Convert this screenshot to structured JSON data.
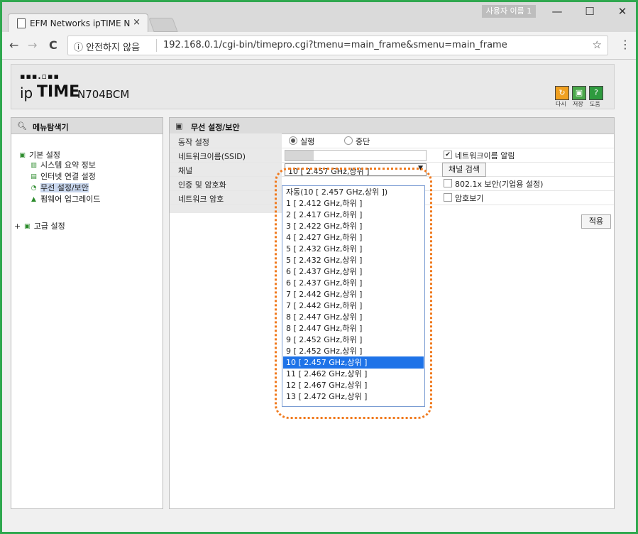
{
  "browser": {
    "tab_title": "EFM Networks ipTIME N",
    "tab_close": "×",
    "profile": "사용자 이름 1",
    "minimize": "—",
    "maximize": "☐",
    "close": "✕",
    "back": "←",
    "forward": "→",
    "reload": "C",
    "security": "ⓘ 안전하지 않음",
    "url": "192.168.0.1/cgi-bin/timepro.cgi?tmenu=main_frame&smenu=main_frame",
    "bookmark": "☆",
    "menu": "⋮"
  },
  "header": {
    "logo_dots": "▪▪▪.▫▪▪",
    "logo_ip": "ip",
    "logo_time": "TIME",
    "model": "N704BCM",
    "toolbar": [
      {
        "label": "다시",
        "icon": "refresh-icon",
        "color": "#f0a020"
      },
      {
        "label": "저장",
        "icon": "save-icon",
        "color": "#4aa84a"
      },
      {
        "label": "도움",
        "icon": "help-icon",
        "color": "#2e9a3e"
      }
    ]
  },
  "sidebar": {
    "title": "메뉴탐색기",
    "groups": [
      {
        "label": "기본 설정",
        "expanded": true,
        "items": [
          "시스템 요약 정보",
          "인터넷 연결 설정",
          "무선 설정/보안",
          "펌웨어 업그레이드"
        ]
      },
      {
        "label": "고급 설정",
        "expanded": false
      }
    ],
    "selected_item": "무선 설정/보안"
  },
  "main": {
    "title": "무선 설정/보안",
    "rows": [
      {
        "label": "동작 설정"
      },
      {
        "label": "네트워크이름(SSID)"
      },
      {
        "label": "채널"
      },
      {
        "label": "인증 및 암호화"
      },
      {
        "label": "네트워크 암호"
      }
    ],
    "mode_options": [
      "실행",
      "중단"
    ],
    "mode_selected": "실행",
    "ssid_broadcast_label": "네트워크이름 알림",
    "ssid_broadcast_checked": true,
    "channel_selected": "10 [ 2.457 GHz,상위 ]",
    "channel_scan_button": "채널 검색",
    "enterprise_label": "802.1x 보안(기업용 설정)",
    "show_password_label": "암호보기",
    "apply_button": "적용"
  },
  "channel_dropdown": {
    "options": [
      "자동(10 [ 2.457 GHz,상위 ])",
      "1 [ 2.412 GHz,하위 ]",
      "2 [ 2.417 GHz,하위 ]",
      "3 [ 2.422 GHz,하위 ]",
      "4 [ 2.427 GHz,하위 ]",
      "5 [ 2.432 GHz,하위 ]",
      "5 [ 2.432 GHz,상위 ]",
      "6 [ 2.437 GHz,상위 ]",
      "6 [ 2.437 GHz,하위 ]",
      "7 [ 2.442 GHz,상위 ]",
      "7 [ 2.442 GHz,하위 ]",
      "8 [ 2.447 GHz,상위 ]",
      "8 [ 2.447 GHz,하위 ]",
      "9 [ 2.452 GHz,하위 ]",
      "9 [ 2.452 GHz,상위 ]",
      "10 [ 2.457 GHz,상위 ]",
      "11 [ 2.462 GHz,상위 ]",
      "12 [ 2.467 GHz,상위 ]",
      "13 [ 2.472 GHz,상위 ]"
    ],
    "selected_index": 15
  }
}
